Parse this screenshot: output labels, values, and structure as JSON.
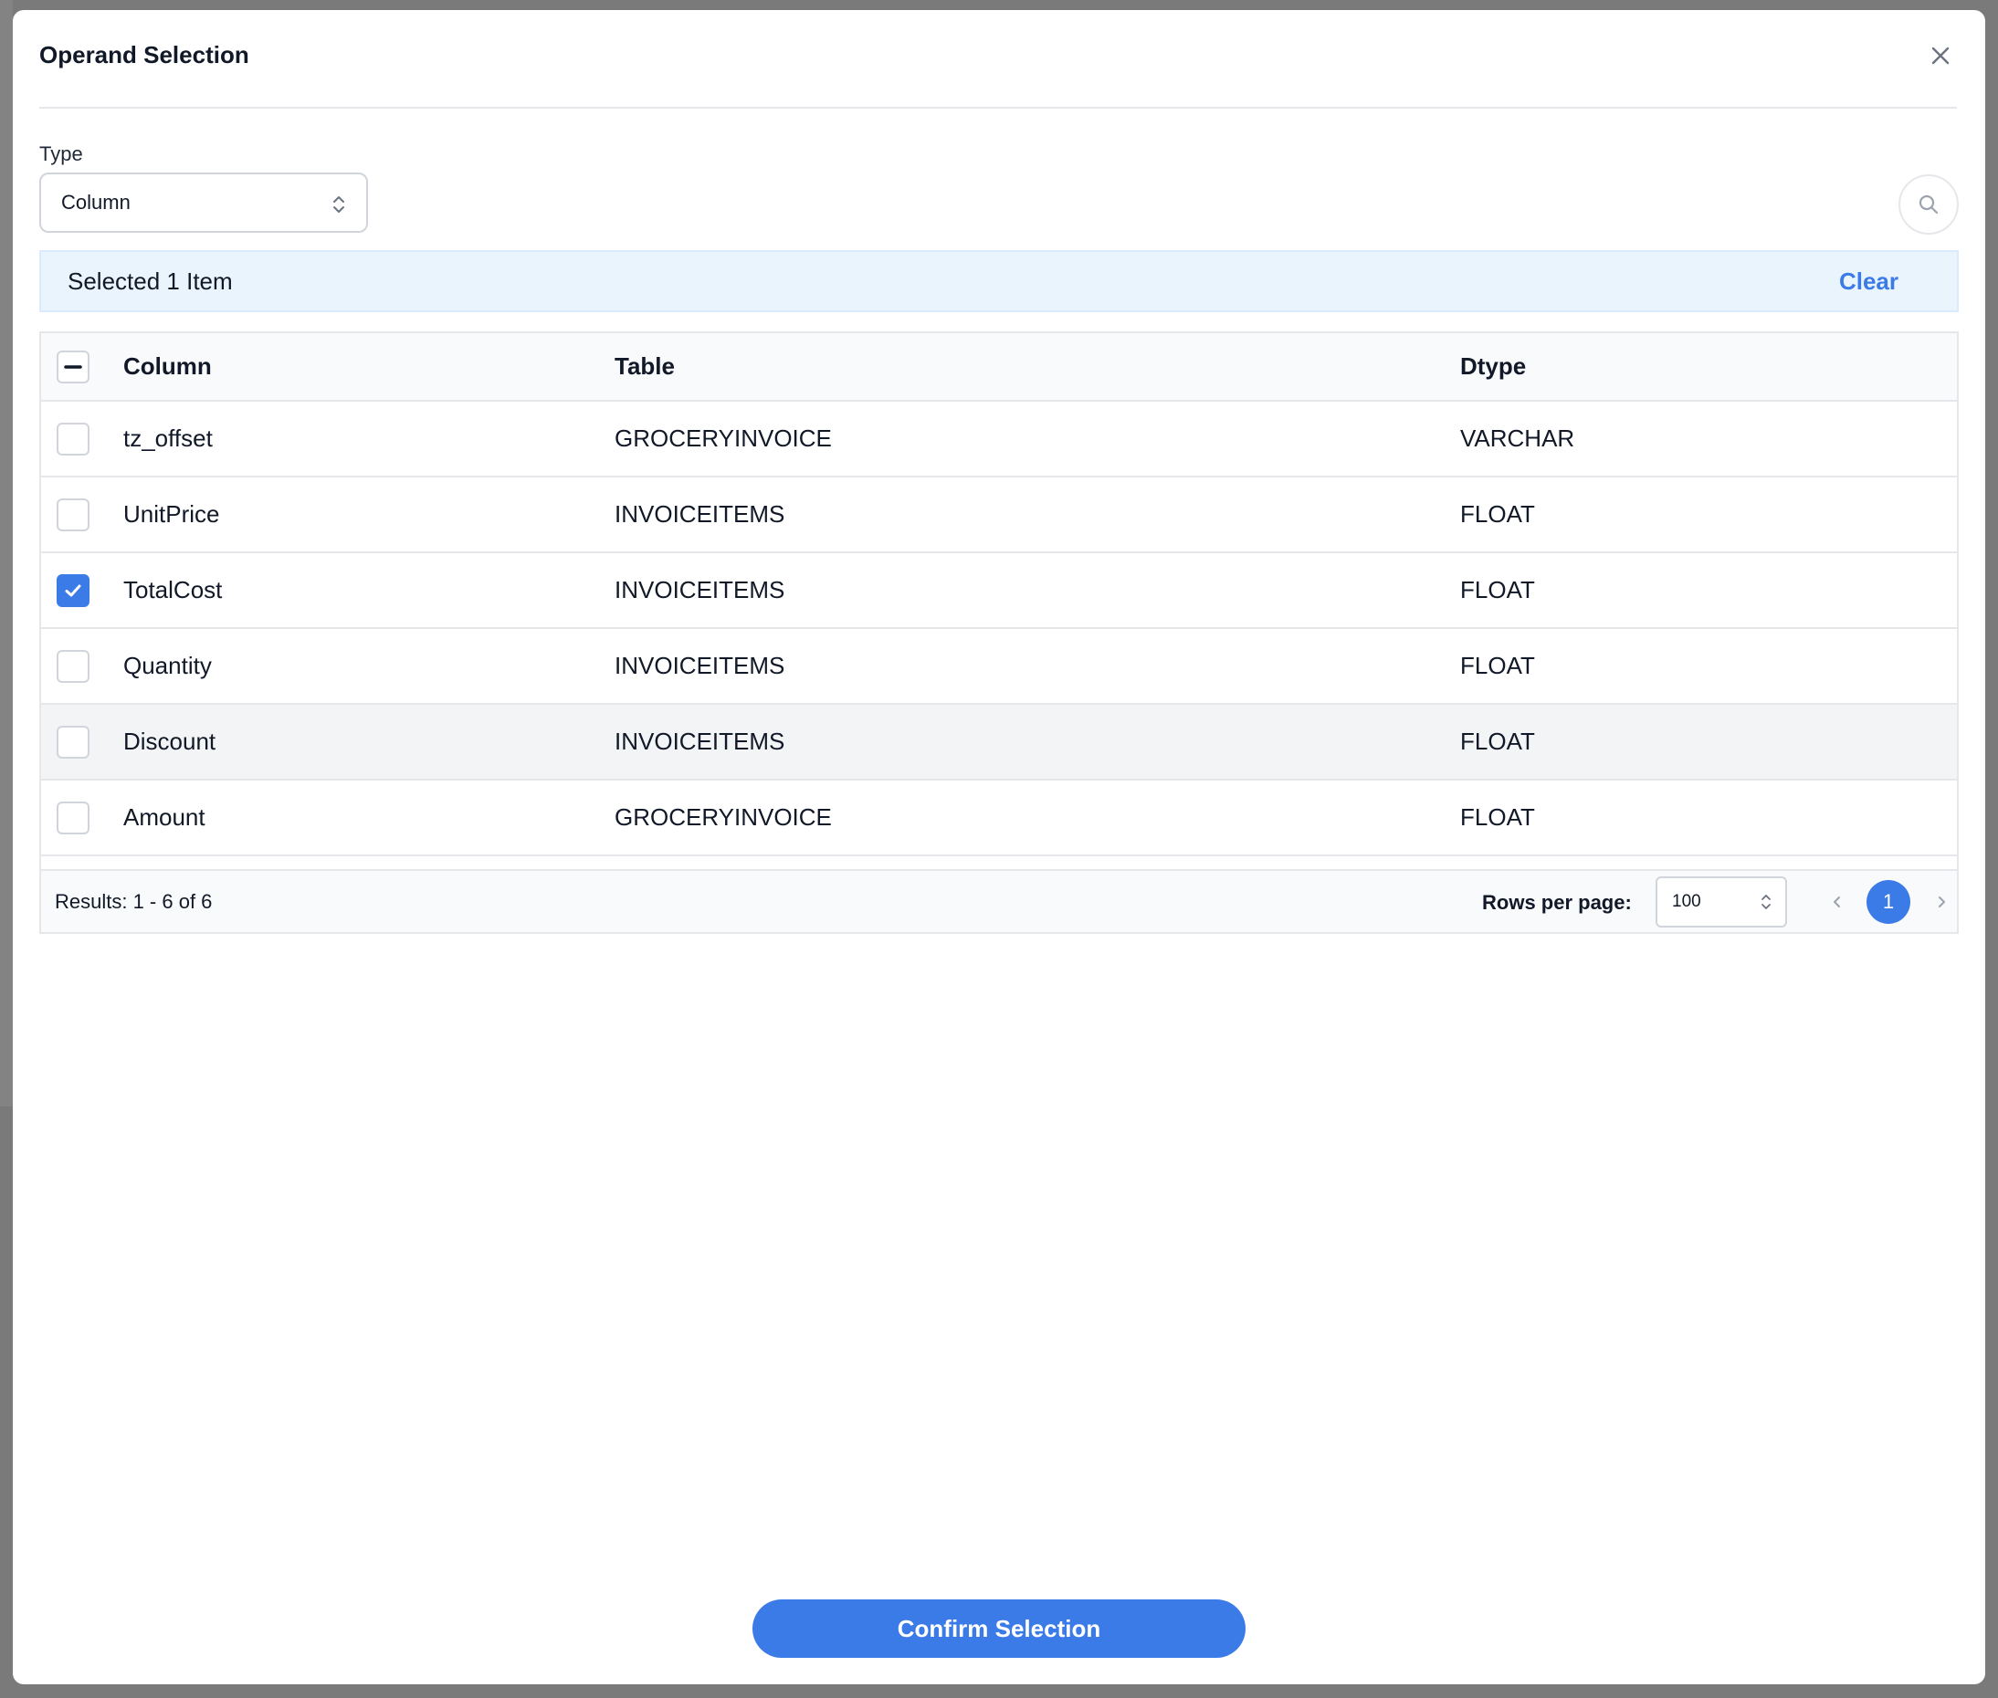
{
  "modal": {
    "title": "Operand Selection",
    "type_label": "Type",
    "type_value": "Column"
  },
  "selection": {
    "text": "Selected 1 Item",
    "clear_label": "Clear"
  },
  "table": {
    "headers": [
      "Column",
      "Table",
      "Dtype"
    ],
    "rows": [
      {
        "column": "tz_offset",
        "table": "GROCERYINVOICE",
        "dtype": "VARCHAR",
        "checked": false
      },
      {
        "column": "UnitPrice",
        "table": "INVOICEITEMS",
        "dtype": "FLOAT",
        "checked": false
      },
      {
        "column": "TotalCost",
        "table": "INVOICEITEMS",
        "dtype": "FLOAT",
        "checked": true
      },
      {
        "column": "Quantity",
        "table": "INVOICEITEMS",
        "dtype": "FLOAT",
        "checked": false
      },
      {
        "column": "Discount",
        "table": "INVOICEITEMS",
        "dtype": "FLOAT",
        "checked": false
      },
      {
        "column": "Amount",
        "table": "GROCERYINVOICE",
        "dtype": "FLOAT",
        "checked": false
      }
    ]
  },
  "footer": {
    "results_text": "Results: 1 - 6 of 6",
    "rows_label": "Rows per page:",
    "rows_value": "100",
    "current_page": "1"
  },
  "confirm_label": "Confirm Selection",
  "colors": {
    "accent": "#3b7be8",
    "selection_bg": "#eaf4fd"
  }
}
